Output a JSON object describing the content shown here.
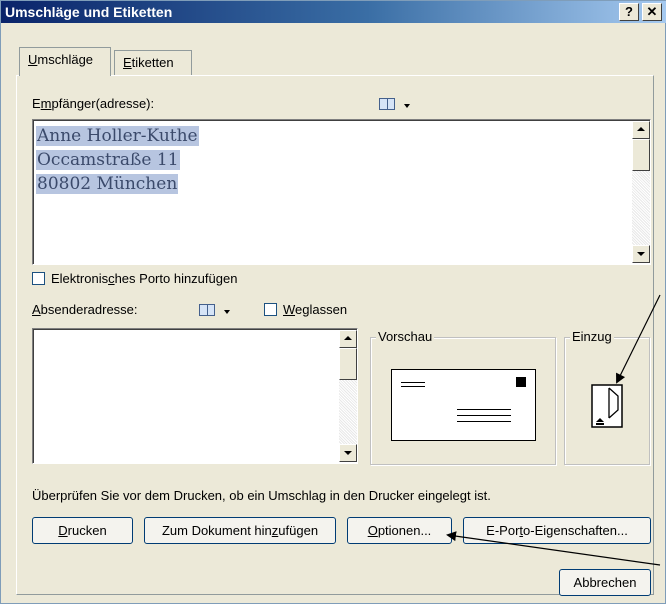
{
  "window": {
    "title": "Umschläge und Etiketten",
    "help_label": "?",
    "close_label": "✕"
  },
  "tabs": [
    {
      "pre": "",
      "key": "U",
      "post": "mschläge"
    },
    {
      "pre": "",
      "key": "E",
      "post": "tiketten"
    }
  ],
  "recipient": {
    "label_pre": "E",
    "label_key": "m",
    "label_post": "pfänger(adresse):",
    "lines": [
      "Anne Holler-Kuthe",
      "Occamstraße 11",
      "80802 München"
    ]
  },
  "eporto_checkbox": {
    "pre": "Elektronis",
    "key": "c",
    "post": "hes Porto hinzufügen"
  },
  "sender": {
    "label_pre": "",
    "label_key": "A",
    "label_post": "bsenderadresse:",
    "omit_pre": "",
    "omit_key": "W",
    "omit_post": "eglassen"
  },
  "preview": {
    "legend": "Vorschau"
  },
  "feed": {
    "legend": "Einzug"
  },
  "hint_text": "Überprüfen Sie vor dem Drucken, ob ein Umschlag in den Drucker eingelegt ist.",
  "buttons": {
    "print": {
      "pre": "",
      "key": "D",
      "post": "rucken"
    },
    "add_doc": {
      "pre": "Zum Dokument hin",
      "key": "z",
      "post": "ufügen"
    },
    "options": {
      "pre": "",
      "key": "O",
      "post": "ptionen..."
    },
    "eporto_props": {
      "pre": "E-Por",
      "key": "t",
      "post": "o-Eigenschaften..."
    },
    "cancel": "Abbrechen"
  },
  "colors": {
    "title_start": "#0a246a",
    "title_end": "#a6caf0",
    "dialog_bg": "#ece9d8",
    "selection": "#b7c5e0"
  }
}
